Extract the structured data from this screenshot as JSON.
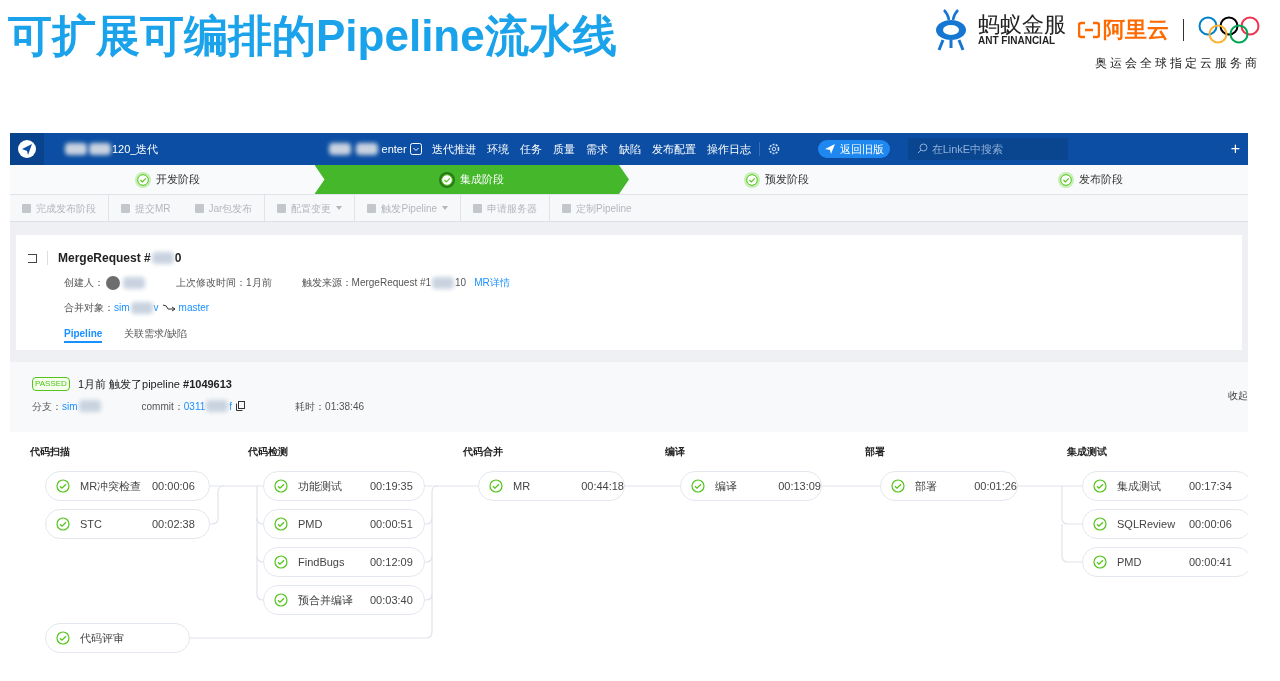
{
  "slide_title": "可扩展可编排的Pipeline流水线",
  "logos": {
    "ant_name": "蚂蚁金服",
    "ant_sub": "ANT FINANCIAL",
    "aliyun": "阿里云",
    "tagline": "奥运会全球指定云服务商"
  },
  "header": {
    "project_suffix": "120_迭代",
    "app_suffix": "enter",
    "nav": [
      "迭代推进",
      "环境",
      "任务",
      "质量",
      "需求",
      "缺陷",
      "发布配置",
      "操作日志"
    ],
    "back_button": "返回旧版",
    "search": {
      "placeholder": "在LinkE中搜索"
    },
    "plus": "+"
  },
  "phases": [
    {
      "label": "开发阶段",
      "selected": false
    },
    {
      "label": "集成阶段",
      "selected": true
    },
    {
      "label": "预发阶段",
      "selected": false
    },
    {
      "label": "发布阶段",
      "selected": false
    }
  ],
  "toolbar": [
    {
      "label": "完成发布阶段",
      "dropdown": false,
      "sep": true
    },
    {
      "label": "提交MR",
      "dropdown": false,
      "sep": false
    },
    {
      "label": "Jar包发布",
      "dropdown": false,
      "sep": true
    },
    {
      "label": "配置变更",
      "dropdown": true,
      "sep": true
    },
    {
      "label": "触发Pipeline",
      "dropdown": true,
      "sep": true
    },
    {
      "label": "申请服务器",
      "dropdown": false,
      "sep": true
    },
    {
      "label": "定制Pipeline",
      "dropdown": false,
      "sep": false
    }
  ],
  "mr": {
    "title_prefix": "MergeRequest #",
    "title_suffix": "0",
    "creator_label": "创建人：",
    "modified_label": "上次修改时间：",
    "modified": "1月前",
    "source_label": "触发来源：",
    "source_prefix": "MergeRequest #1",
    "source_suffix": "10",
    "detail_link": "MR详情",
    "merge_label": "合并对象：",
    "branch_prefix": "sim",
    "branch_suffix": "v",
    "target": "master",
    "tabs": [
      {
        "label": "Pipeline",
        "selected": true
      },
      {
        "label": "关联需求/缺陷",
        "selected": false
      }
    ]
  },
  "run": {
    "status": "PASSED",
    "summary": "1月前 触发了pipeline **#1049613**",
    "branch_label": "分支：",
    "branch": "sim",
    "commit_label": "commit：",
    "commit_prefix": "0311",
    "commit_suffix": "f",
    "duration_label": "耗时：",
    "duration": "01:38:46",
    "collapse": "收起"
  },
  "stages": [
    {
      "title": "代码扫描",
      "jobs": [
        {
          "name": "MR冲突检查",
          "time": "00:00:06",
          "passed": true
        },
        {
          "name": "STC",
          "time": "00:02:38",
          "passed": true
        },
        {
          "name": "代码评审",
          "passed": true
        }
      ]
    },
    {
      "title": "代码检测",
      "jobs": [
        {
          "name": "功能测试",
          "time": "00:19:35",
          "passed": true
        },
        {
          "name": "PMD",
          "time": "00:00:51",
          "passed": true
        },
        {
          "name": "FindBugs",
          "time": "00:12:09",
          "passed": true
        },
        {
          "name": "预合并编译",
          "time": "00:03:40",
          "passed": true
        }
      ]
    },
    {
      "title": "代码合并",
      "jobs": [
        {
          "name": "MR",
          "time": "00:44:18",
          "passed": true
        }
      ]
    },
    {
      "title": "编译",
      "jobs": [
        {
          "name": "编译",
          "time": "00:13:09",
          "passed": true
        }
      ]
    },
    {
      "title": "部署",
      "jobs": [
        {
          "name": "部署",
          "time": "00:01:26",
          "passed": true
        }
      ]
    },
    {
      "title": "集成测试",
      "jobs": [
        {
          "name": "集成测试",
          "time": "00:17:34",
          "passed": true
        },
        {
          "name": "SQLReview",
          "time": "00:00:06",
          "passed": true
        },
        {
          "name": "PMD",
          "time": "00:00:41",
          "passed": true
        }
      ]
    }
  ]
}
